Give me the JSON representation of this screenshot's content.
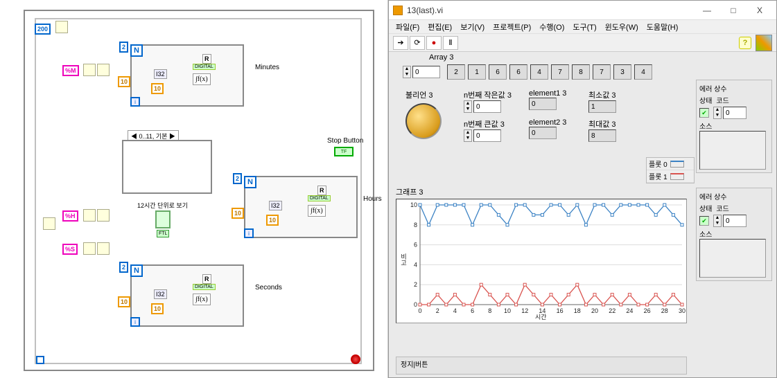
{
  "window": {
    "title": "13(last).vi",
    "min": "—",
    "max": "□",
    "close": "X"
  },
  "menus": {
    "file": "파일(F)",
    "edit": "편집(E)",
    "view": "보기(V)",
    "project": "프로젝트(P)",
    "operate": "수행(O)",
    "tools": "도구(T)",
    "window": "윈도우(W)",
    "help": "도움말(H)"
  },
  "toolbar": {
    "run": "➔",
    "run_cont": "⟳",
    "abort": "●",
    "pause": "Ⅱ",
    "help": "?"
  },
  "block_diagram": {
    "delay_ms": "200",
    "fmt_M": "%M",
    "fmt_H": "%H",
    "fmt_S": "%S",
    "loop_N_const": 2,
    "loop_in_const": 10,
    "i32_label": "I32",
    "integral_label": "∫f(x)",
    "digital_label": "DIGITAL",
    "R_label": "R",
    "sig_minutes": "Minutes",
    "sig_hours": "Hours",
    "sig_seconds": "Seconds",
    "stop_label": "Stop Button",
    "stop_tf": "TF",
    "case_selector": "◀ 0..11, 기본 ▶",
    "twelve_hr_label": "12시간 단위로 보기",
    "ftl_label": "FTL",
    "ten": "10"
  },
  "front_panel": {
    "array_label": "Array 3",
    "array_index": 0,
    "array_values": [
      2,
      1,
      6,
      6,
      4,
      7,
      8,
      7,
      3,
      4
    ],
    "bool_label": "불리언 3",
    "nth_small_label": "n번째 작은값 3",
    "nth_small_val": 0,
    "elem1_label": "element1 3",
    "elem1_val": 0,
    "min_label": "최소값 3",
    "min_val": 1,
    "nth_big_label": "n번째 큰값 3",
    "nth_big_val": 0,
    "elem2_label": "element2 3",
    "elem2_val": 0,
    "max_label": "최대값 3",
    "max_val": 8,
    "legend0": "플롯 0",
    "legend1": "플롯 1",
    "graph_label": "그래프 3",
    "x_axis": "시간",
    "y_axis": "비고",
    "err_label": "에러 상수",
    "err_status": "상태",
    "err_code": "코드",
    "err_code_val": 0,
    "err_source": "소스",
    "stop_section": "정지|버튼"
  },
  "chart_data": {
    "type": "line",
    "x": [
      0,
      1,
      2,
      3,
      4,
      5,
      6,
      7,
      8,
      9,
      10,
      11,
      12,
      13,
      14,
      15,
      16,
      17,
      18,
      19,
      20,
      21,
      22,
      23,
      24,
      25,
      26,
      27,
      28,
      29,
      30
    ],
    "series": [
      {
        "name": "플롯 0",
        "color": "#3b82c4",
        "values": [
          10,
          8,
          10,
          10,
          10,
          10,
          8,
          10,
          10,
          9,
          8,
          10,
          10,
          9,
          9,
          10,
          10,
          9,
          10,
          8,
          10,
          10,
          9,
          10,
          10,
          10,
          10,
          9,
          10,
          9,
          8
        ]
      },
      {
        "name": "플롯 1",
        "color": "#d9534f",
        "values": [
          0,
          0,
          1,
          0,
          1,
          0,
          0,
          2,
          1,
          0,
          1,
          0,
          2,
          1,
          0,
          1,
          0,
          1,
          2,
          0,
          1,
          0,
          1,
          0,
          1,
          0,
          0,
          1,
          0,
          1,
          0
        ]
      }
    ],
    "xlabel": "시간",
    "ylabel": "비고",
    "xlim": [
      0,
      30
    ],
    "ylim": [
      0,
      10
    ]
  }
}
